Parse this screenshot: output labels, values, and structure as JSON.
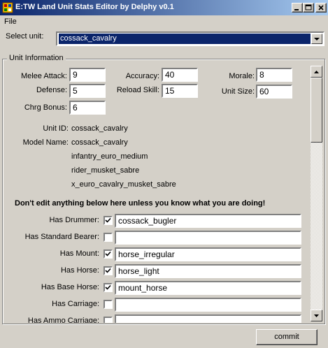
{
  "window": {
    "title": "E:TW Land Unit Stats Editor by Delphy v0.1"
  },
  "menu": {
    "file": "File"
  },
  "unit_select": {
    "label": "Select unit:",
    "value": "cossack_cavalry"
  },
  "group": {
    "title": "Unit Information"
  },
  "stats": {
    "melee_attack_label": "Melee Attack:",
    "melee_attack": "9",
    "defense_label": "Defense:",
    "defense": "5",
    "charge_bonus_label": "Chrg Bonus:",
    "charge_bonus": "6",
    "accuracy_label": "Accuracy:",
    "accuracy": "40",
    "reload_label": "Reload Skill:",
    "reload": "15",
    "morale_label": "Morale:",
    "morale": "8",
    "unit_size_label": "Unit Size:",
    "unit_size": "60"
  },
  "info": {
    "unit_id_label": "Unit ID:",
    "unit_id": "cossack_cavalry",
    "model_name_label": "Model Name:",
    "model_names": [
      "cossack_cavalry",
      "infantry_euro_medium",
      "rider_musket_sabre",
      "x_euro_cavalry_musket_sabre"
    ]
  },
  "warning": "Don't edit anything below here unless you know what you are doing!",
  "flags": [
    {
      "label": "Has Drummer:",
      "checked": true,
      "value": "cossack_bugler"
    },
    {
      "label": "Has Standard Bearer:",
      "checked": false,
      "value": ""
    },
    {
      "label": "Has Mount:",
      "checked": true,
      "value": "horse_irregular"
    },
    {
      "label": "Has Horse:",
      "checked": true,
      "value": "horse_light"
    },
    {
      "label": "Has Base Horse:",
      "checked": true,
      "value": "mount_horse"
    },
    {
      "label": "Has Carriage:",
      "checked": false,
      "value": ""
    },
    {
      "label": "Has Ammo Carriage:",
      "checked": false,
      "value": ""
    }
  ],
  "commit_label": "commit",
  "colors": {
    "title_bar_start": "#0a246a",
    "title_bar_end": "#a6caf0",
    "face": "#d4d0c8",
    "selection": "#0a246a"
  }
}
